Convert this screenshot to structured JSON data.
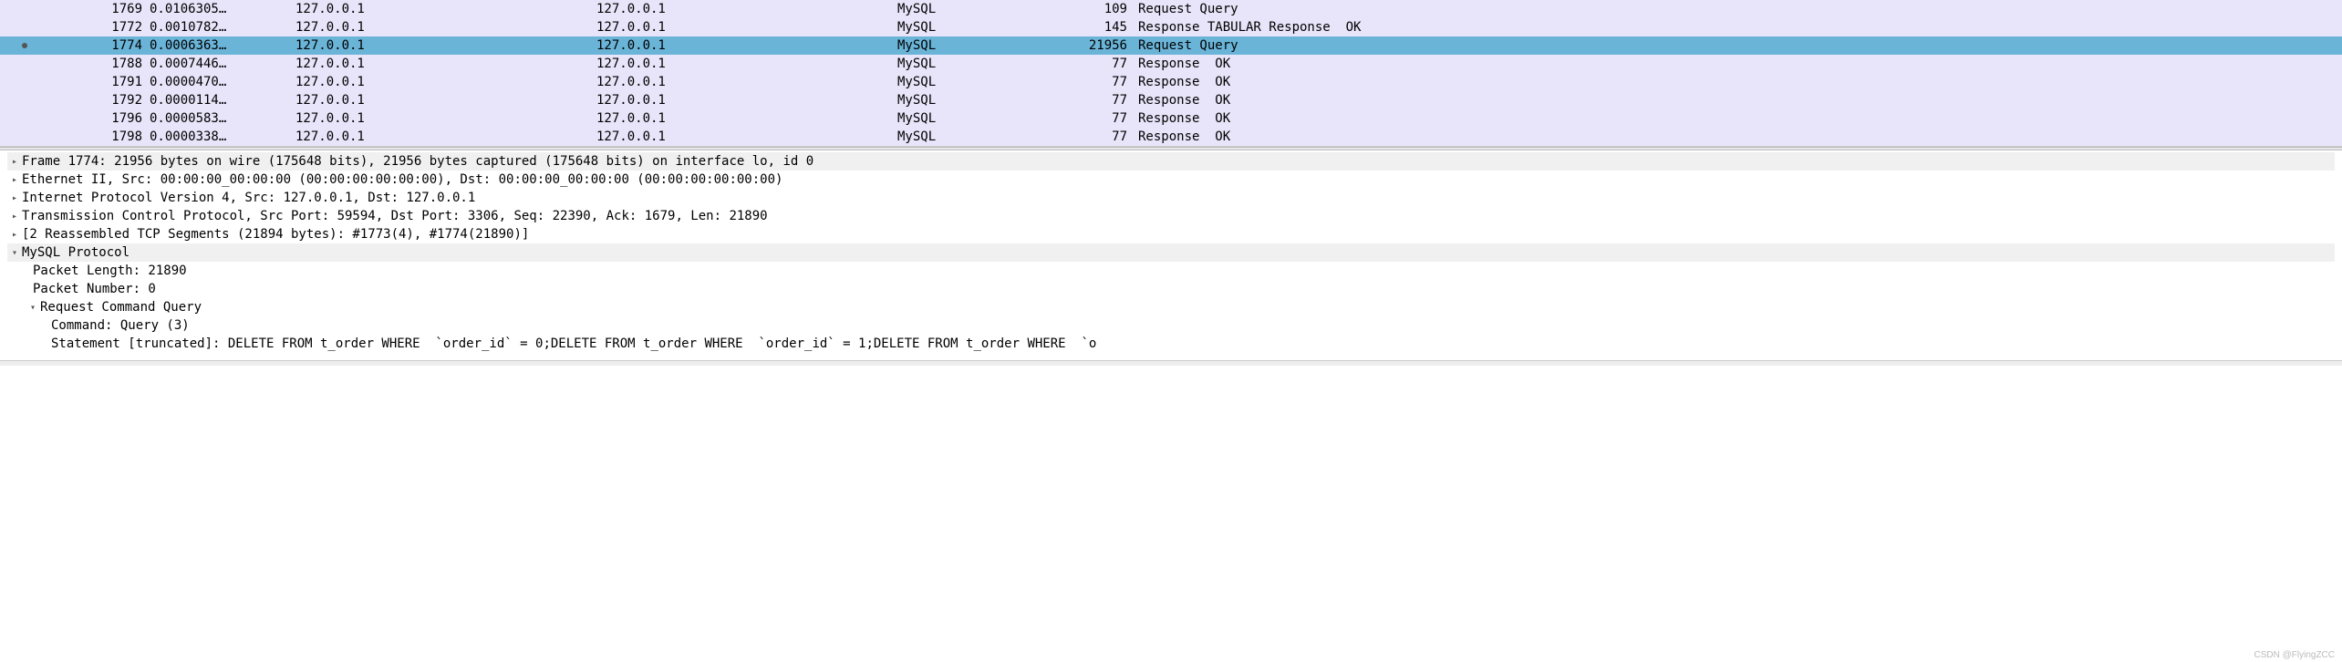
{
  "packets": [
    {
      "marked": false,
      "selected": false,
      "no": "1769",
      "time": "0.0106305…",
      "src": "127.0.0.1",
      "dst": "127.0.0.1",
      "proto": "MySQL",
      "len": "109",
      "info": "Request Query"
    },
    {
      "marked": false,
      "selected": false,
      "no": "1772",
      "time": "0.0010782…",
      "src": "127.0.0.1",
      "dst": "127.0.0.1",
      "proto": "MySQL",
      "len": "145",
      "info": "Response TABULAR Response  OK"
    },
    {
      "marked": true,
      "selected": true,
      "no": "1774",
      "time": "0.0006363…",
      "src": "127.0.0.1",
      "dst": "127.0.0.1",
      "proto": "MySQL",
      "len": "21956",
      "info": "Request Query"
    },
    {
      "marked": false,
      "selected": false,
      "no": "1788",
      "time": "0.0007446…",
      "src": "127.0.0.1",
      "dst": "127.0.0.1",
      "proto": "MySQL",
      "len": "77",
      "info": "Response  OK"
    },
    {
      "marked": false,
      "selected": false,
      "no": "1791",
      "time": "0.0000470…",
      "src": "127.0.0.1",
      "dst": "127.0.0.1",
      "proto": "MySQL",
      "len": "77",
      "info": "Response  OK"
    },
    {
      "marked": false,
      "selected": false,
      "no": "1792",
      "time": "0.0000114…",
      "src": "127.0.0.1",
      "dst": "127.0.0.1",
      "proto": "MySQL",
      "len": "77",
      "info": "Response  OK"
    },
    {
      "marked": false,
      "selected": false,
      "no": "1796",
      "time": "0.0000583…",
      "src": "127.0.0.1",
      "dst": "127.0.0.1",
      "proto": "MySQL",
      "len": "77",
      "info": "Response  OK"
    },
    {
      "marked": false,
      "selected": false,
      "no": "1798",
      "time": "0.0000338…",
      "src": "127.0.0.1",
      "dst": "127.0.0.1",
      "proto": "MySQL",
      "len": "77",
      "info": "Response  OK"
    }
  ],
  "details": {
    "frame": "Frame 1774: 21956 bytes on wire (175648 bits), 21956 bytes captured (175648 bits) on interface lo, id 0",
    "ethernet": "Ethernet II, Src: 00:00:00_00:00:00 (00:00:00:00:00:00), Dst: 00:00:00_00:00:00 (00:00:00:00:00:00)",
    "ip": "Internet Protocol Version 4, Src: 127.0.0.1, Dst: 127.0.0.1",
    "tcp": "Transmission Control Protocol, Src Port: 59594, Dst Port: 3306, Seq: 22390, Ack: 1679, Len: 21890",
    "reassembled": "[2 Reassembled TCP Segments (21894 bytes): #1773(4), #1774(21890)]",
    "mysql_heading": "MySQL Protocol",
    "packet_length": "Packet Length: 21890",
    "packet_number": "Packet Number: 0",
    "req_cmd_query": "Request Command Query",
    "command": "Command: Query (3)",
    "statement": "Statement [truncated]: DELETE FROM t_order WHERE  `order_id` = 0;DELETE FROM t_order WHERE  `order_id` = 1;DELETE FROM t_order WHERE  `o"
  },
  "glyphs": {
    "collapsed": "▸",
    "expanded": "▾"
  },
  "watermark": "CSDN @FlyingZCC"
}
